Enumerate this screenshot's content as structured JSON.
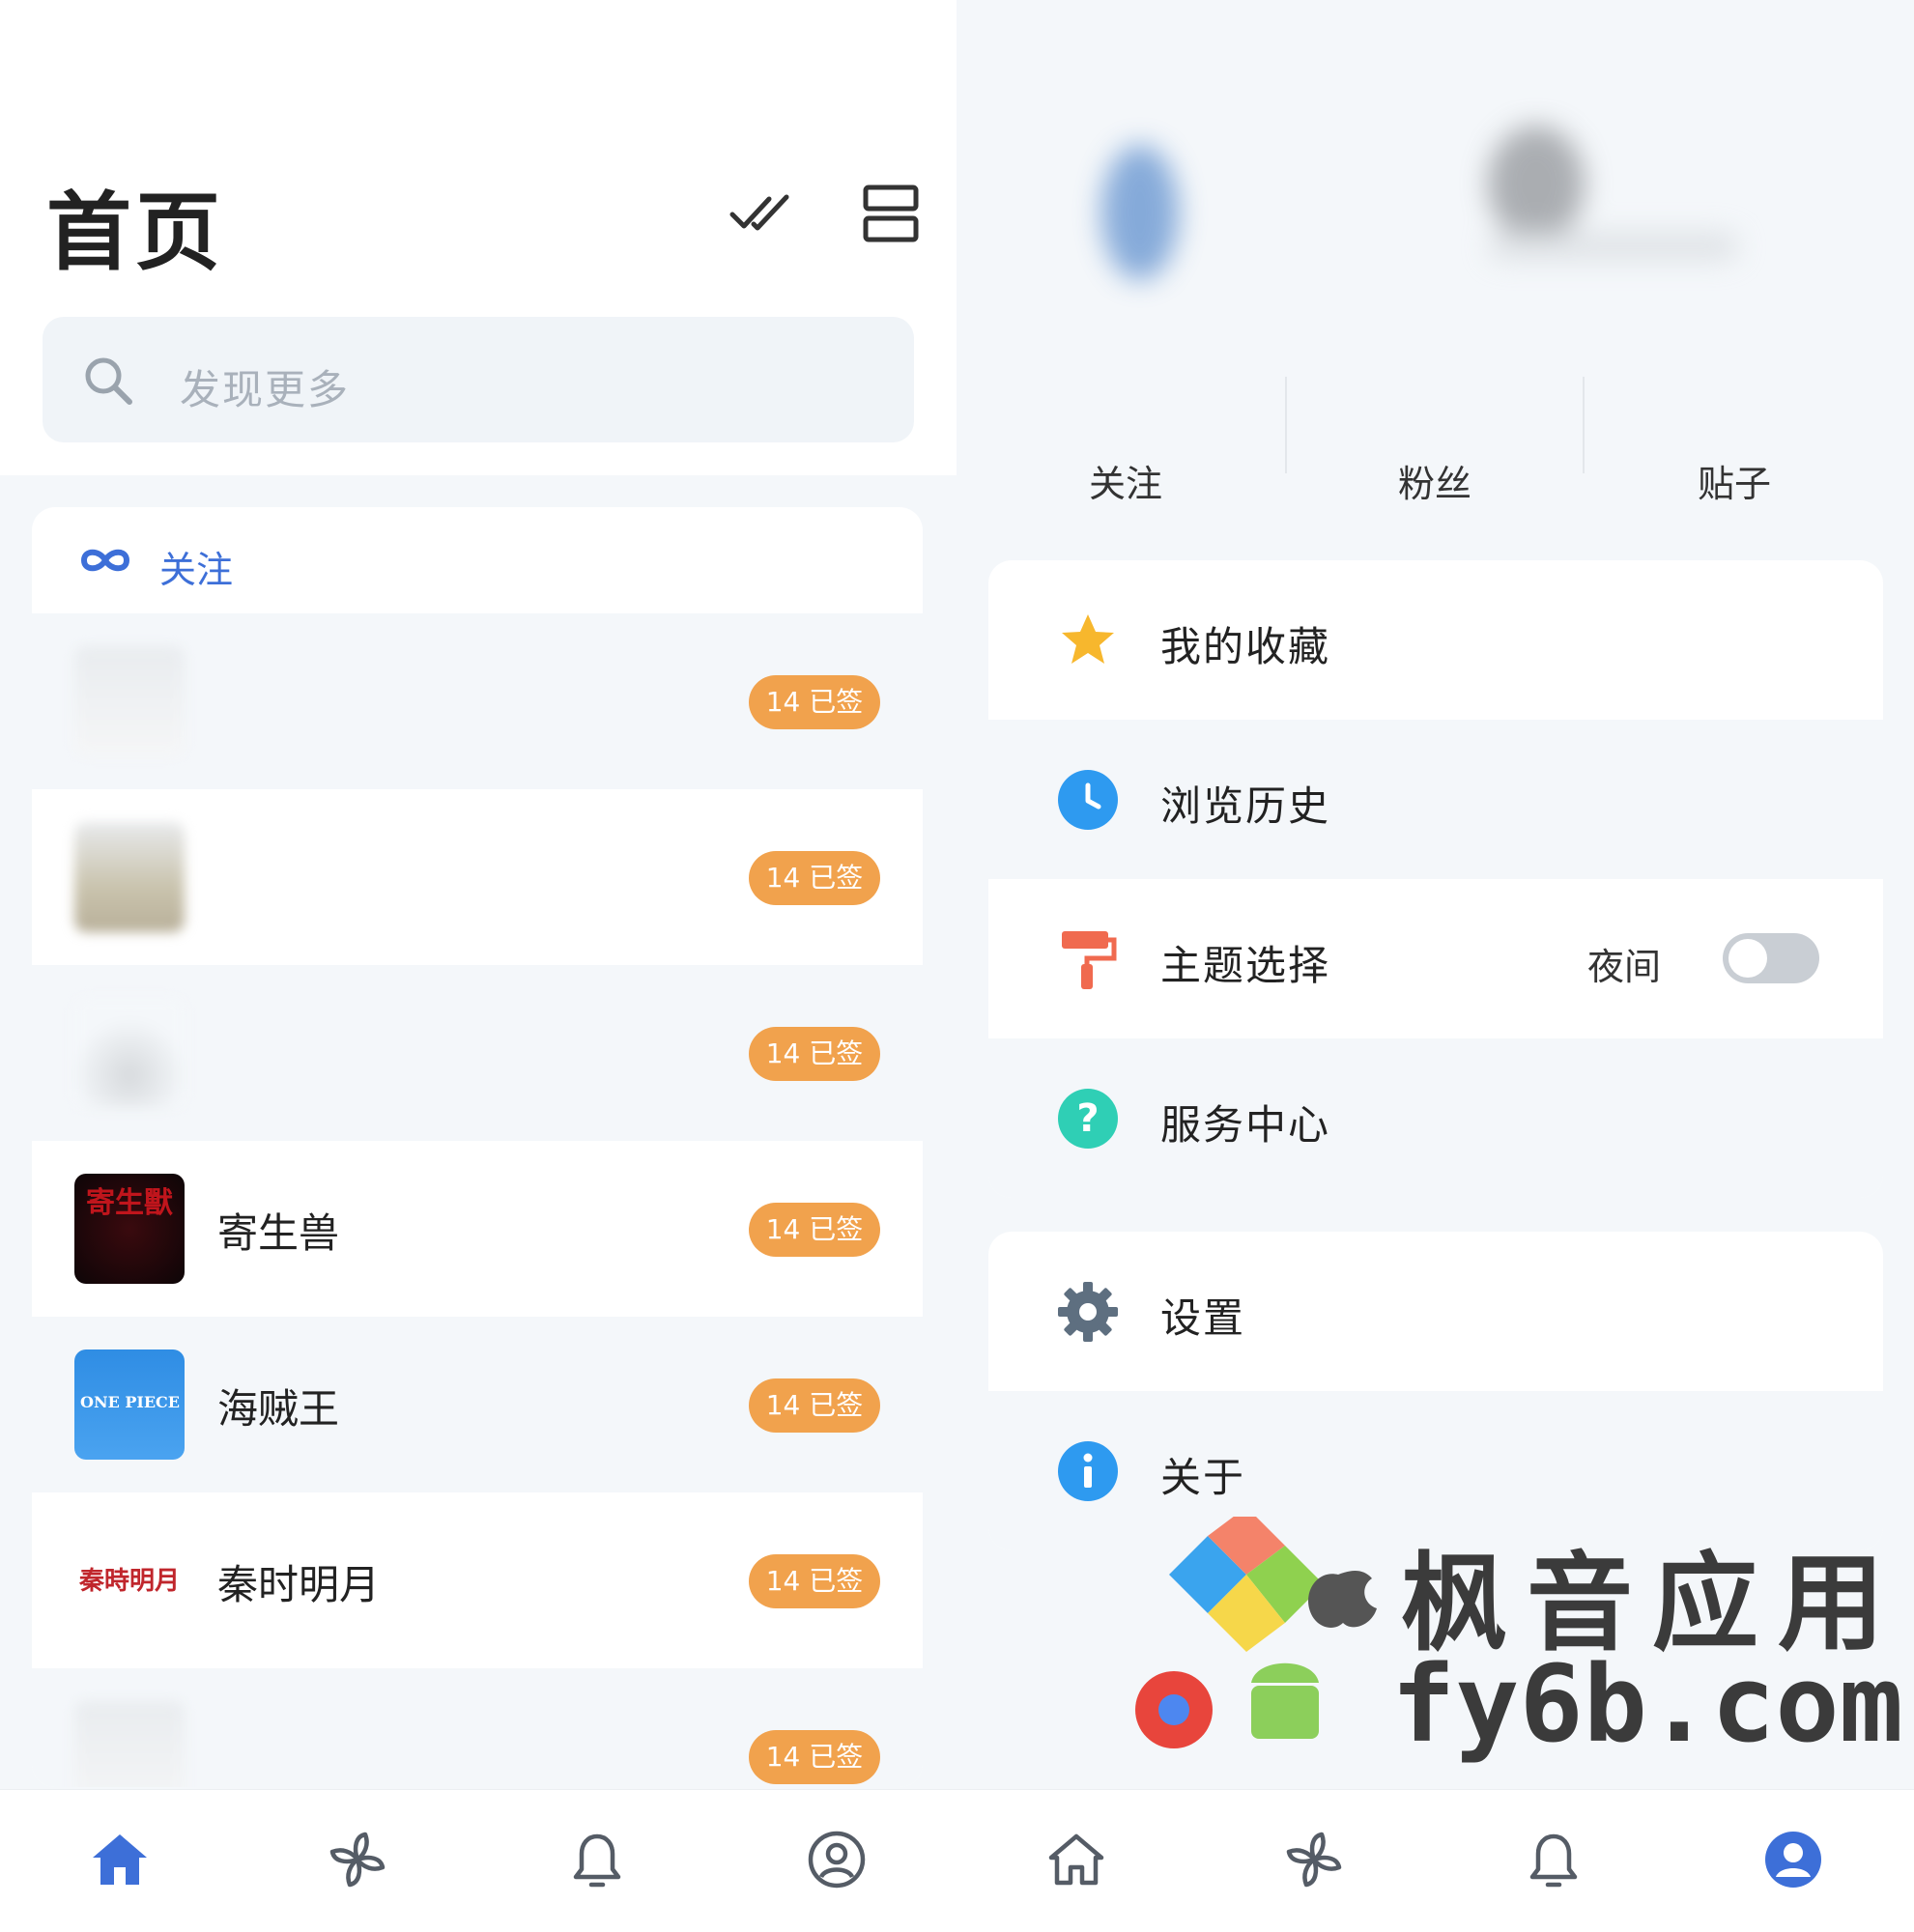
{
  "left": {
    "header": {
      "title": "首页"
    },
    "search": {
      "placeholder": "发现更多"
    },
    "follow": {
      "title": "关注",
      "items": [
        {
          "name": "",
          "badge": "14 已签"
        },
        {
          "name": "",
          "badge": "14 已签"
        },
        {
          "name": "",
          "badge": "14 已签"
        },
        {
          "name": "寄生兽",
          "badge": "14 已签",
          "avatar_text": "寄生獸"
        },
        {
          "name": "海贼王",
          "badge": "14 已签",
          "avatar_text": "ONE PIECE BAR"
        },
        {
          "name": "秦时明月",
          "badge": "14 已签",
          "avatar_text": "秦時明月"
        },
        {
          "name": "",
          "badge": "14 已签"
        }
      ]
    },
    "nav": [
      {
        "icon": "home-icon",
        "active": true
      },
      {
        "icon": "pinwheel-icon",
        "active": false
      },
      {
        "icon": "bell-icon",
        "active": false
      },
      {
        "icon": "user-circle-icon",
        "active": false
      }
    ]
  },
  "right": {
    "stats": [
      {
        "label": "关注"
      },
      {
        "label": "粉丝"
      },
      {
        "label": "贴子"
      }
    ],
    "menu1": [
      {
        "label": "我的收藏",
        "icon": "star-icon"
      },
      {
        "label": "浏览历史",
        "icon": "clock-icon"
      },
      {
        "label": "主题选择",
        "icon": "paint-roller-icon",
        "extra": "夜间",
        "toggle": false
      },
      {
        "label": "服务中心",
        "icon": "help-icon"
      }
    ],
    "menu2": [
      {
        "label": "设置",
        "icon": "gear-icon"
      },
      {
        "label": "关于",
        "icon": "info-icon"
      }
    ],
    "nav": [
      {
        "icon": "home-icon",
        "active": false
      },
      {
        "icon": "pinwheel-icon",
        "active": false
      },
      {
        "icon": "bell-icon",
        "active": false
      },
      {
        "icon": "user-circle-icon",
        "active": true
      }
    ]
  },
  "watermark": {
    "cn": "枫音应用",
    "en": "fy6b.com"
  },
  "colors": {
    "accent": "#3d6fd8",
    "badge": "#f1a24d",
    "background": "#f4f7fa"
  }
}
